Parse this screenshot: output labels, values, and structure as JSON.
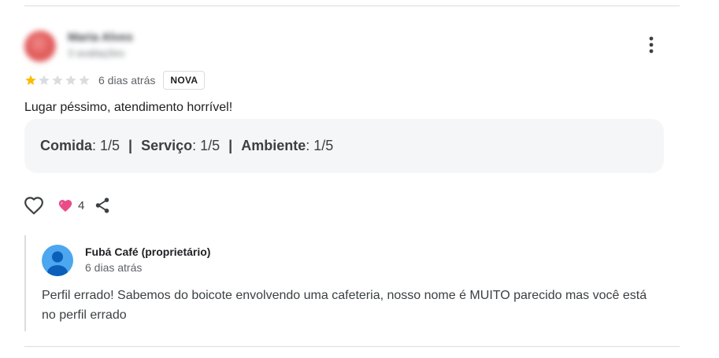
{
  "review": {
    "reviewer_name": "Maria Alves",
    "reviewer_meta": "3 avaliações",
    "rating": 1,
    "max_rating": 5,
    "time_ago": "6 dias atrás",
    "new_badge": "NOVA",
    "text": "Lugar péssimo, atendimento horrível!",
    "subratings": [
      {
        "label": "Comida",
        "value": ": 1/5"
      },
      {
        "label": "Serviço",
        "value": ": 1/5"
      },
      {
        "label": "Ambiente",
        "value": ": 1/5"
      }
    ],
    "separator": "|",
    "reaction_count": "4"
  },
  "owner_response": {
    "name": "Fubá Café (proprietário)",
    "time_ago": "6 dias atrás",
    "text": "Perfil errado! Sabemos do boicote envolvendo uma cafeteria, nosso nome é MUITO parecido mas você está no perfil errado"
  },
  "colors": {
    "star_filled": "#fbbc04",
    "star_empty": "#dadce0",
    "heart_reaction": "#ea4c89",
    "owner_avatar": "#4ca6f0",
    "divider": "#dadce0",
    "subratings_bg": "#f5f6f7"
  },
  "icons": {
    "more": "more-vert-icon",
    "like": "heart-outline-icon",
    "reaction": "heart-filled-icon",
    "share": "share-icon",
    "owner_avatar": "person-avatar-icon"
  }
}
